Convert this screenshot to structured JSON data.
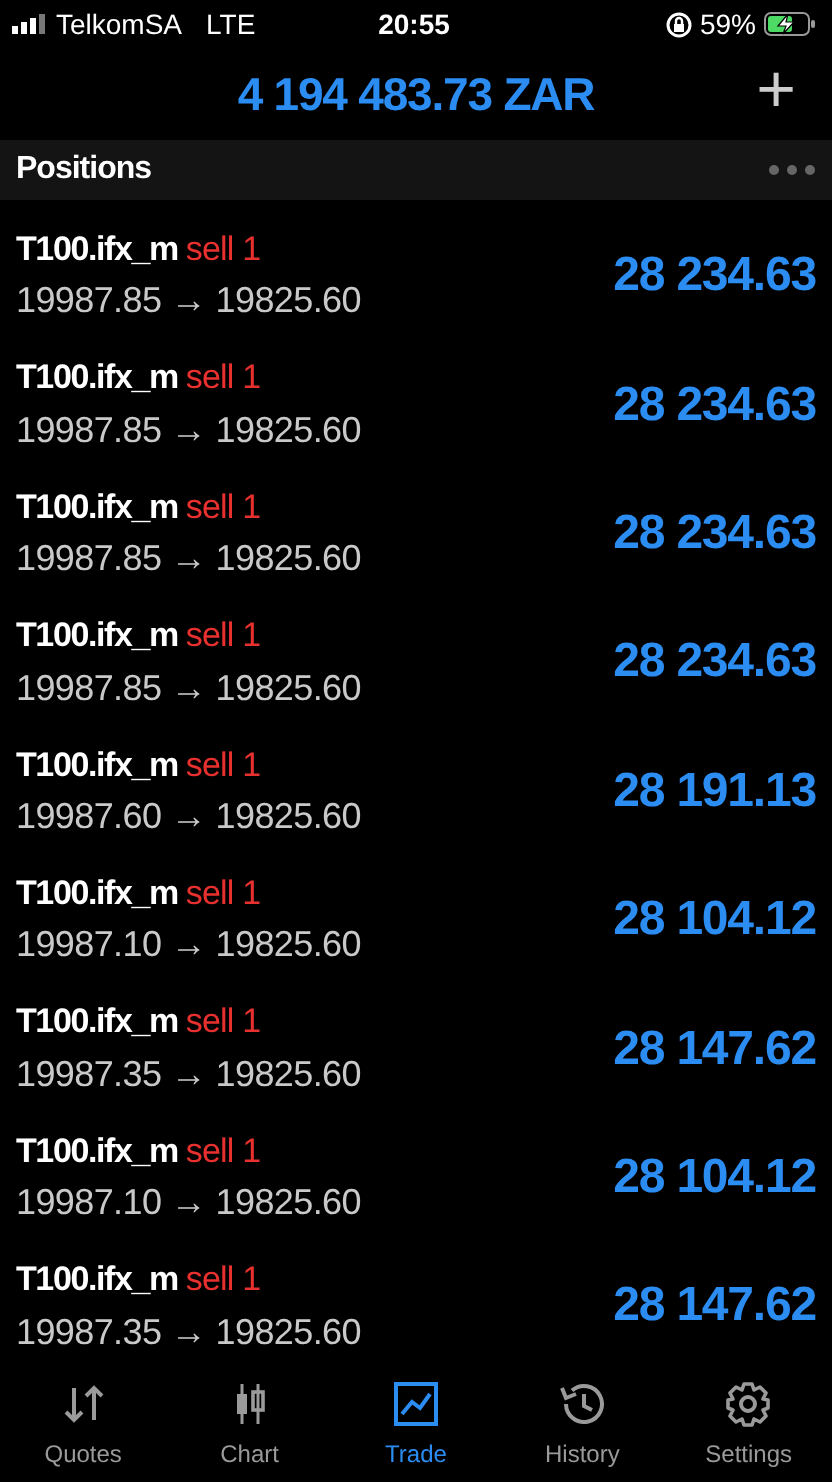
{
  "status_bar": {
    "carrier": "TelkomSA",
    "network": "LTE",
    "time": "20:55",
    "battery": "59%"
  },
  "header": {
    "balance": "4 194 483.73 ZAR",
    "add_button": "+"
  },
  "section": {
    "title": "Positions"
  },
  "positions": [
    {
      "symbol": "T100.ifx_m",
      "kind": "sell",
      "order": "sell 1",
      "open_price": "19987.85",
      "arrow": "→",
      "current_price": "19825.60",
      "profit": "28 234.63"
    },
    {
      "symbol": "T100.ifx_m",
      "kind": "sell",
      "order": "sell 1",
      "open_price": "19987.85",
      "arrow": "→",
      "current_price": "19825.60",
      "profit": "28 234.63"
    },
    {
      "symbol": "T100.ifx_m",
      "kind": "sell",
      "order": "sell 1",
      "open_price": "19987.85",
      "arrow": "→",
      "current_price": "19825.60",
      "profit": "28 234.63"
    },
    {
      "symbol": "T100.ifx_m",
      "kind": "sell",
      "order": "sell 1",
      "open_price": "19987.85",
      "arrow": "→",
      "current_price": "19825.60",
      "profit": "28 234.63"
    },
    {
      "symbol": "T100.ifx_m",
      "kind": "sell",
      "order": "sell 1",
      "open_price": "19987.60",
      "arrow": "→",
      "current_price": "19825.60",
      "profit": "28 191.13"
    },
    {
      "symbol": "T100.ifx_m",
      "kind": "sell",
      "order": "sell 1",
      "open_price": "19987.10",
      "arrow": "→",
      "current_price": "19825.60",
      "profit": "28 104.12"
    },
    {
      "symbol": "T100.ifx_m",
      "kind": "sell",
      "order": "sell 1",
      "open_price": "19987.35",
      "arrow": "→",
      "current_price": "19825.60",
      "profit": "28 147.62"
    },
    {
      "symbol": "T100.ifx_m",
      "kind": "sell",
      "order": "sell 1",
      "open_price": "19987.10",
      "arrow": "→",
      "current_price": "19825.60",
      "profit": "28 104.12"
    },
    {
      "symbol": "T100.ifx_m",
      "kind": "sell",
      "order": "sell 1",
      "open_price": "19987.35",
      "arrow": "→",
      "current_price": "19825.60",
      "profit": "28 147.62"
    }
  ],
  "tabs": [
    {
      "kind": "quotes",
      "label": "Quotes",
      "selected": false
    },
    {
      "kind": "chart",
      "label": "Chart",
      "selected": false
    },
    {
      "kind": "trade",
      "label": "Trade",
      "selected": true
    },
    {
      "kind": "history",
      "label": "History",
      "selected": false
    },
    {
      "kind": "settings",
      "label": "Settings",
      "selected": false
    }
  ]
}
